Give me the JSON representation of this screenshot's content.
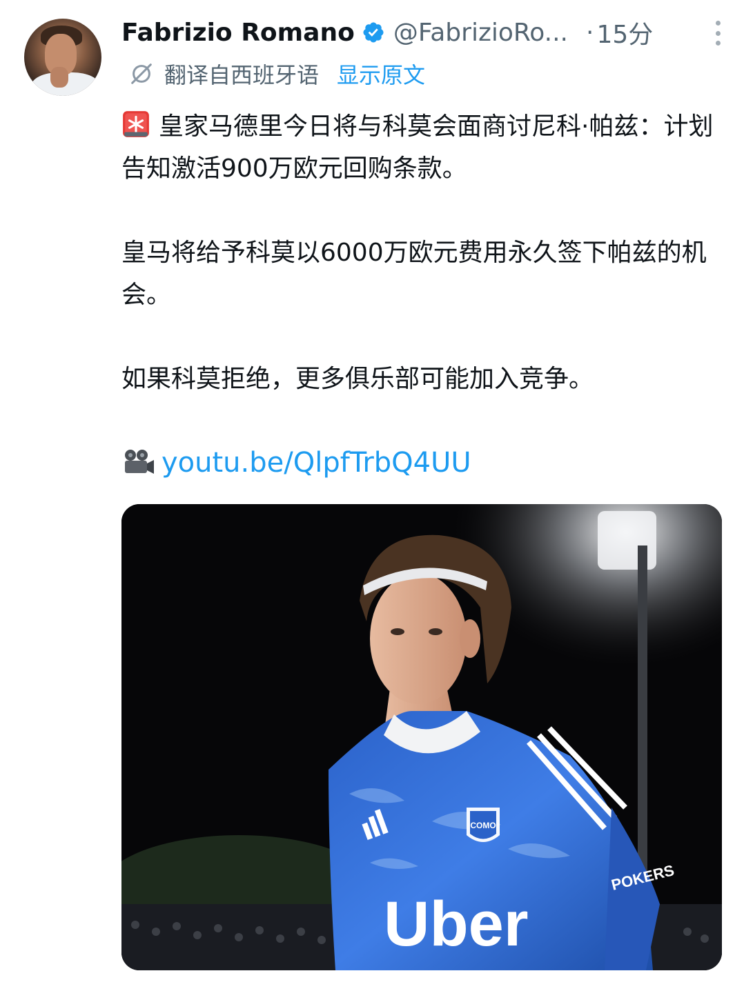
{
  "tweet": {
    "author_name": "Fabrizio Romano",
    "handle": "@FabrizioRo...",
    "dot": "·",
    "time": "15分",
    "translated_note": "翻译自西班牙语",
    "show_original": "显示原文",
    "paragraphs": [
      "皇家马德里今日将与科莫会面商讨尼科·帕兹：计划告知激活900万欧元回购条款。",
      "皇马将给予科莫以6000万欧元费用永久签下帕兹的机会。",
      "如果科莫拒绝，更多俱乐部可能加入竞争。"
    ],
    "link_text": "youtu.be/QlpfTrbQ4UU",
    "media": {
      "shirt_sponsor": "Uber",
      "club_badge": "COMO",
      "sleeve_sponsor": "POKERS"
    },
    "icons": {
      "verified": "verified-badge-icon",
      "more": "more-options-icon",
      "translate": "translate-icon",
      "siren": "siren-emoji",
      "camera": "movie-camera-emoji"
    },
    "colors": {
      "link": "#1d9bf0",
      "muted": "#536471",
      "text": "#0f1419"
    }
  }
}
